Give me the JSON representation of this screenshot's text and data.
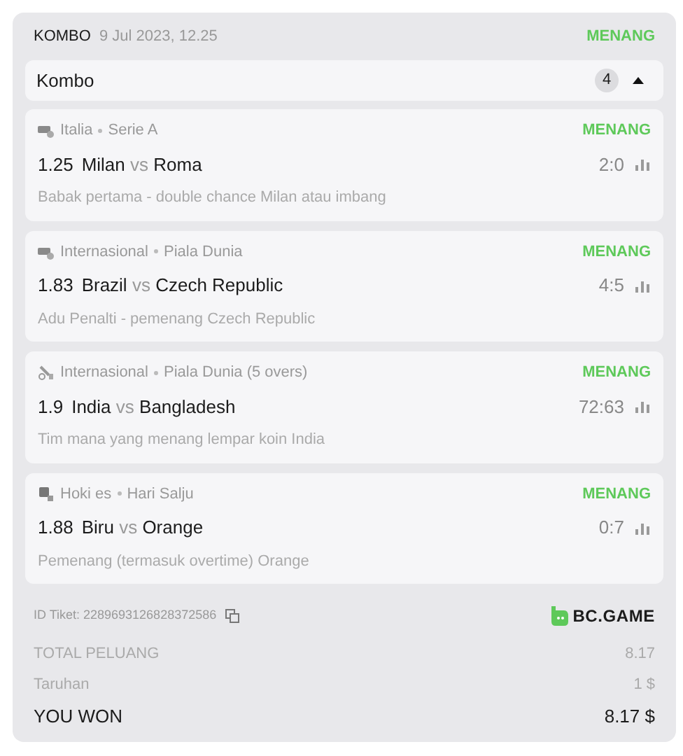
{
  "header": {
    "type": "KOMBO",
    "date": "9 Jul 2023, 12.25",
    "status": "MENANG"
  },
  "group": {
    "title": "Kombo",
    "count": "4",
    "expanded": true
  },
  "bets": [
    {
      "kind": "soccer",
      "category": "Italia",
      "league": "Serie A",
      "status": "MENANG",
      "odds": "1.25",
      "home": "Milan",
      "vs": "vs",
      "away": "Roma",
      "score": "2:0",
      "market": "Babak pertama - double chance Milan atau imbang"
    },
    {
      "kind": "soccer",
      "category": "Internasional",
      "league": "Piala Dunia",
      "status": "MENANG",
      "odds": "1.83",
      "home": "Brazil",
      "vs": "vs",
      "away": "Czech Republic",
      "score": "4:5",
      "market": "Adu Penalti - pemenang Czech Republic"
    },
    {
      "kind": "cricket",
      "category": "Internasional",
      "league": "Piala Dunia (5 overs)",
      "status": "MENANG",
      "odds": "1.9",
      "home": "India",
      "vs": "vs",
      "away": "Bangladesh",
      "score": "72:63",
      "market": "Tim mana yang menang lempar koin India"
    },
    {
      "kind": "hockey",
      "category": "Hoki es",
      "league": "Hari Salju",
      "status": "MENANG",
      "odds": "1.88",
      "home": "Biru",
      "vs": "vs",
      "away": "Orange",
      "score": "0:7",
      "market": "Pemenang (termasuk overtime) Orange"
    }
  ],
  "ticket": {
    "label": "ID Tiket: 2289693126828372586",
    "brand": "BC.GAME"
  },
  "summary": [
    {
      "kind": "muted",
      "label": "TOTAL PELUANG",
      "value": "8.17"
    },
    {
      "kind": "muted",
      "label": "Taruhan",
      "value": "1 $"
    },
    {
      "kind": "strong",
      "label": "YOU WON",
      "value": "8.17 $"
    }
  ]
}
